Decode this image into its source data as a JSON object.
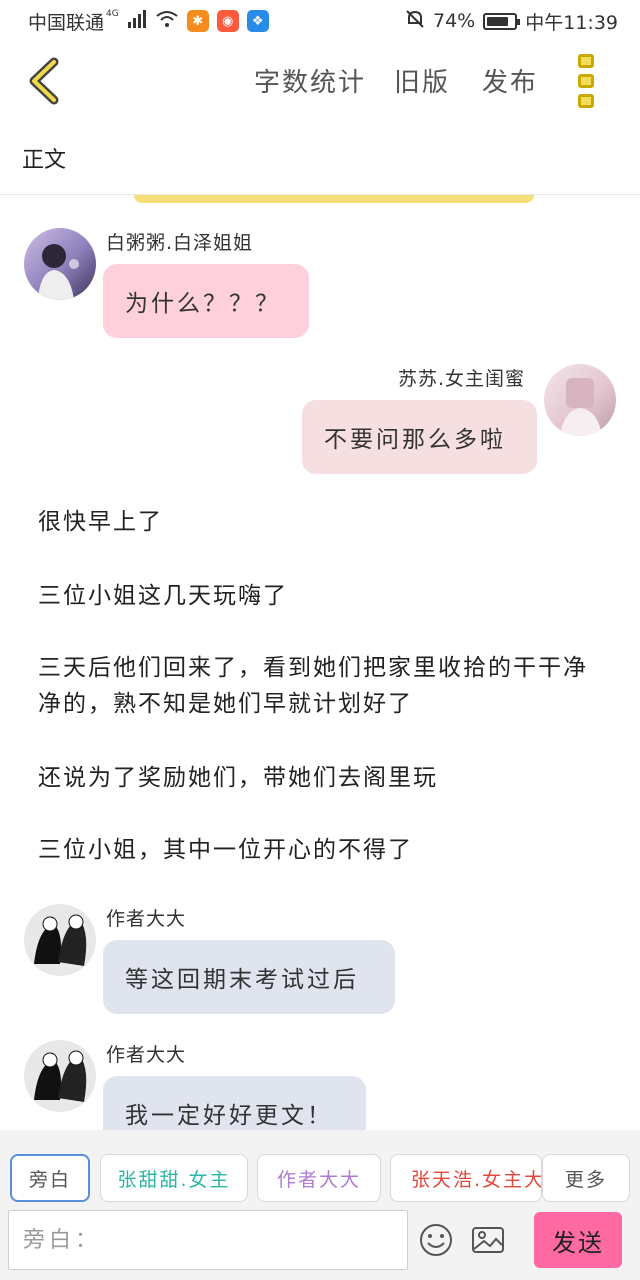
{
  "status_bar": {
    "carrier": "中国联通",
    "network": "4G",
    "battery": "74%",
    "time": "中午11:39"
  },
  "toolbar": {
    "word_count_label": "字数统计",
    "old_version_label": "旧版",
    "publish_label": "发布",
    "accent_color": "#f0d040"
  },
  "mode_label": "正文",
  "messages": [
    {
      "speaker": "白粥粥.白泽姐姐",
      "text": "为什么？？？",
      "bubble_color": "#fdd0db"
    },
    {
      "speaker": "苏苏.女主闺蜜",
      "text": "不要问那么多啦",
      "bubble_color": "#f5dfe0"
    }
  ],
  "narration": [
    "很快早上了",
    "三位小姐这几天玩嗨了",
    "三天后他们回来了，看到她们把家里收拾的干干净净的，熟不知是她们早就计划好了",
    "还说为了奖励她们，带她们去阁里玩",
    "三位小姐，其中一位开心的不得了"
  ],
  "author_messages": [
    {
      "speaker": "作者大大",
      "text": "等这回期末考试过后",
      "bubble_color": "#dfe4ee"
    },
    {
      "speaker": "作者大大",
      "text": "我一定好好更文！",
      "bubble_color": "#dfe4ee"
    }
  ],
  "roles": [
    {
      "label": "旁白",
      "color": "#555555"
    },
    {
      "label": "张甜甜.女主",
      "color": "#2ab5a5"
    },
    {
      "label": "作者大大",
      "color": "#b07ad6"
    },
    {
      "label": "张天浩.女主大",
      "color": "#e0483c"
    },
    {
      "label": "更多",
      "color": "#555555"
    }
  ],
  "input": {
    "placeholder": "旁白："
  },
  "send_label": "发送"
}
